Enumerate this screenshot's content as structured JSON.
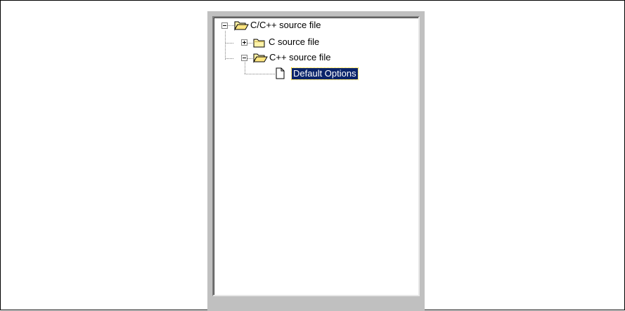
{
  "tree": {
    "nodes": [
      {
        "label": "C/C++ source file",
        "expander": "minus",
        "icon": "folder-open-icon",
        "level": 0
      },
      {
        "label": "C source file",
        "expander": "plus",
        "icon": "folder-closed-icon",
        "level": 1
      },
      {
        "label": "C++ source file",
        "expander": "minus",
        "icon": "folder-open-icon",
        "level": 1
      },
      {
        "label": "Default Options",
        "expander": "none",
        "icon": "document-icon",
        "level": 2,
        "selected": true
      }
    ]
  },
  "colors": {
    "selection_bg": "#0a246a",
    "selection_text": "#ffffff",
    "folder_fill": "#fff3a8",
    "panel_gray": "#c0c0c0"
  }
}
